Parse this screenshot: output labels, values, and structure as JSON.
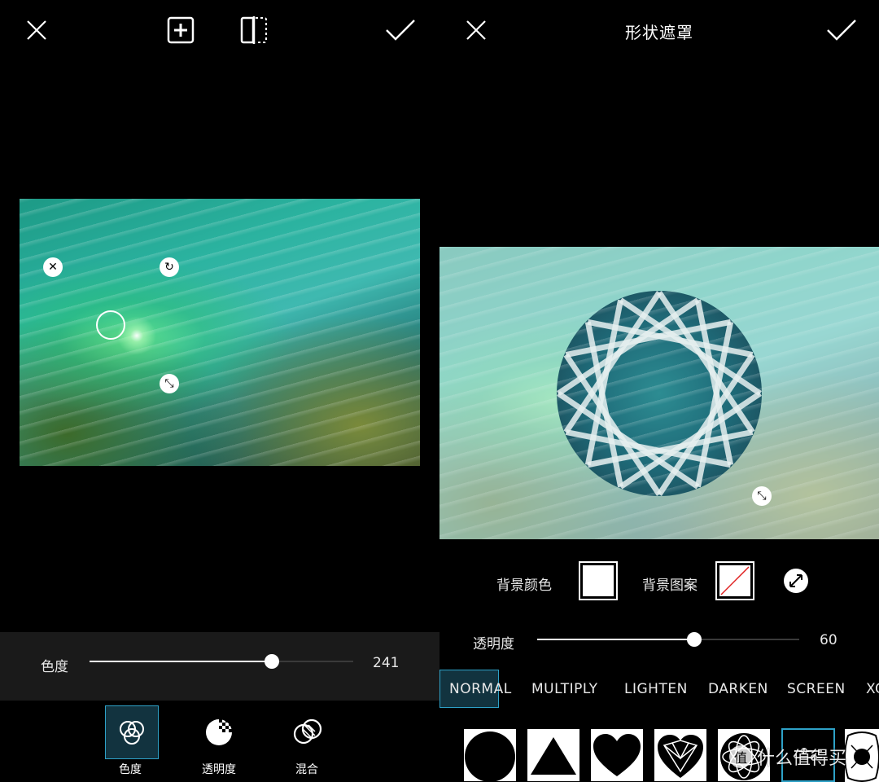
{
  "left": {
    "toolbar": {
      "close_icon": "close-icon",
      "add_icon": "add-square-icon",
      "compare_icon": "compare-icon",
      "confirm_icon": "check-icon"
    },
    "slider": {
      "label": "色度",
      "value": "241",
      "fraction": 0.69
    },
    "tools": [
      {
        "label": "色度",
        "icon": "hue-circles-icon",
        "selected": true
      },
      {
        "label": "透明度",
        "icon": "opacity-icon",
        "selected": false
      },
      {
        "label": "混合",
        "icon": "blend-icon",
        "selected": false
      }
    ]
  },
  "right": {
    "header": {
      "title": "形状遮罩"
    },
    "bg_color_label": "背景颜色",
    "bg_pattern_label": "背景图案",
    "opacity": {
      "label": "透明度",
      "value": "60",
      "fraction": 0.6
    },
    "blend_modes": [
      "NORMAL",
      "MULTIPLY",
      "LIGHTEN",
      "DARKEN",
      "SCREEN",
      "XO"
    ],
    "selected_blend": "NORMAL",
    "shapes": [
      "circle-shape",
      "triangle-shape",
      "heart-shape",
      "diamond-shape",
      "flower-shape",
      "selected-shape",
      "ornament-shape"
    ],
    "watermark": "什么值得买"
  },
  "colors": {
    "accent": "#2ea2c8",
    "selected_bg": "#12333f"
  }
}
